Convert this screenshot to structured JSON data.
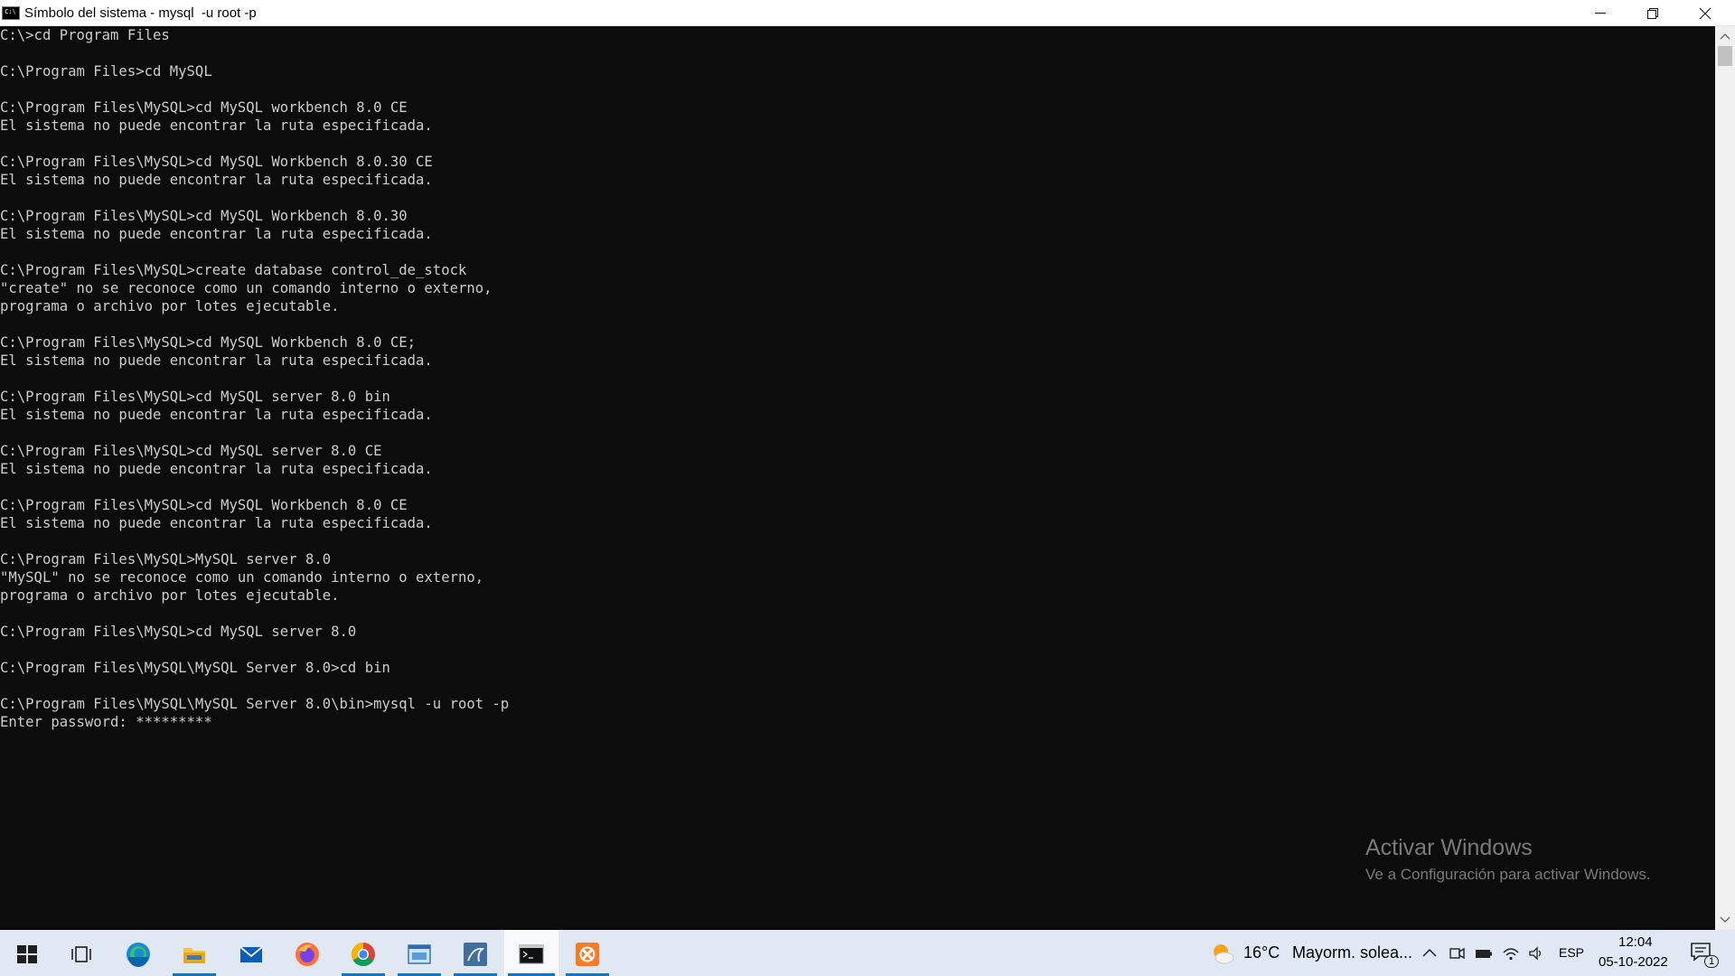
{
  "window": {
    "title": "Símbolo del sistema - mysql  -u root -p",
    "icon": "cmd-icon",
    "icon_text": "C:\\",
    "controls": [
      "minimize-icon",
      "restore-icon",
      "close-icon"
    ]
  },
  "terminal": {
    "lines": [
      "C:\\>cd Program Files",
      "",
      "C:\\Program Files>cd MySQL",
      "",
      "C:\\Program Files\\MySQL>cd MySQL workbench 8.0 CE",
      "El sistema no puede encontrar la ruta especificada.",
      "",
      "C:\\Program Files\\MySQL>cd MySQL Workbench 8.0.30 CE",
      "El sistema no puede encontrar la ruta especificada.",
      "",
      "C:\\Program Files\\MySQL>cd MySQL Workbench 8.0.30",
      "El sistema no puede encontrar la ruta especificada.",
      "",
      "C:\\Program Files\\MySQL>create database control_de_stock",
      "\"create\" no se reconoce como un comando interno o externo,",
      "programa o archivo por lotes ejecutable.",
      "",
      "C:\\Program Files\\MySQL>cd MySQL Workbench 8.0 CE;",
      "El sistema no puede encontrar la ruta especificada.",
      "",
      "C:\\Program Files\\MySQL>cd MySQL server 8.0 bin",
      "El sistema no puede encontrar la ruta especificada.",
      "",
      "C:\\Program Files\\MySQL>cd MySQL server 8.0 CE",
      "El sistema no puede encontrar la ruta especificada.",
      "",
      "C:\\Program Files\\MySQL>cd MySQL Workbench 8.0 CE",
      "El sistema no puede encontrar la ruta especificada.",
      "",
      "C:\\Program Files\\MySQL>MySQL server 8.0",
      "\"MySQL\" no se reconoce como un comando interno o externo,",
      "programa o archivo por lotes ejecutable.",
      "",
      "C:\\Program Files\\MySQL>cd MySQL server 8.0",
      "",
      "C:\\Program Files\\MySQL\\MySQL Server 8.0>cd bin",
      "",
      "C:\\Program Files\\MySQL\\MySQL Server 8.0\\bin>mysql -u root -p",
      "Enter password: *********"
    ]
  },
  "watermark": {
    "title": "Activar Windows",
    "subtitle": "Ve a Configuración para activar Windows."
  },
  "taskbar": {
    "apps": [
      {
        "name": "start-button",
        "icon": "windows-logo-icon"
      },
      {
        "name": "task-view-button",
        "icon": "task-view-icon"
      },
      {
        "name": "edge-button",
        "icon": "edge-icon"
      },
      {
        "name": "file-explorer-button",
        "icon": "folder-icon"
      },
      {
        "name": "mail-button",
        "icon": "mail-icon"
      },
      {
        "name": "firefox-button",
        "icon": "firefox-icon"
      },
      {
        "name": "chrome-button",
        "icon": "chrome-icon"
      },
      {
        "name": "control-panel-button",
        "icon": "window-app-icon"
      },
      {
        "name": "mysql-workbench-button",
        "icon": "mysql-workbench-icon"
      },
      {
        "name": "command-prompt-button",
        "icon": "cmd-icon"
      },
      {
        "name": "xampp-button",
        "icon": "xampp-icon"
      }
    ],
    "weather": {
      "temp": "16°C",
      "text": "Mayorm. solea...",
      "icon": "partly-sunny-icon"
    },
    "tray": {
      "icons": [
        "chevron-up-icon",
        "meet-now-icon",
        "battery-icon",
        "wifi-icon",
        "volume-icon"
      ],
      "language": "ESP",
      "time": "12:04",
      "date": "05-10-2022",
      "notification_count": "1"
    },
    "colors": {
      "taskbar_bg": "#dfe8f3",
      "accent": "#0078d4"
    }
  }
}
